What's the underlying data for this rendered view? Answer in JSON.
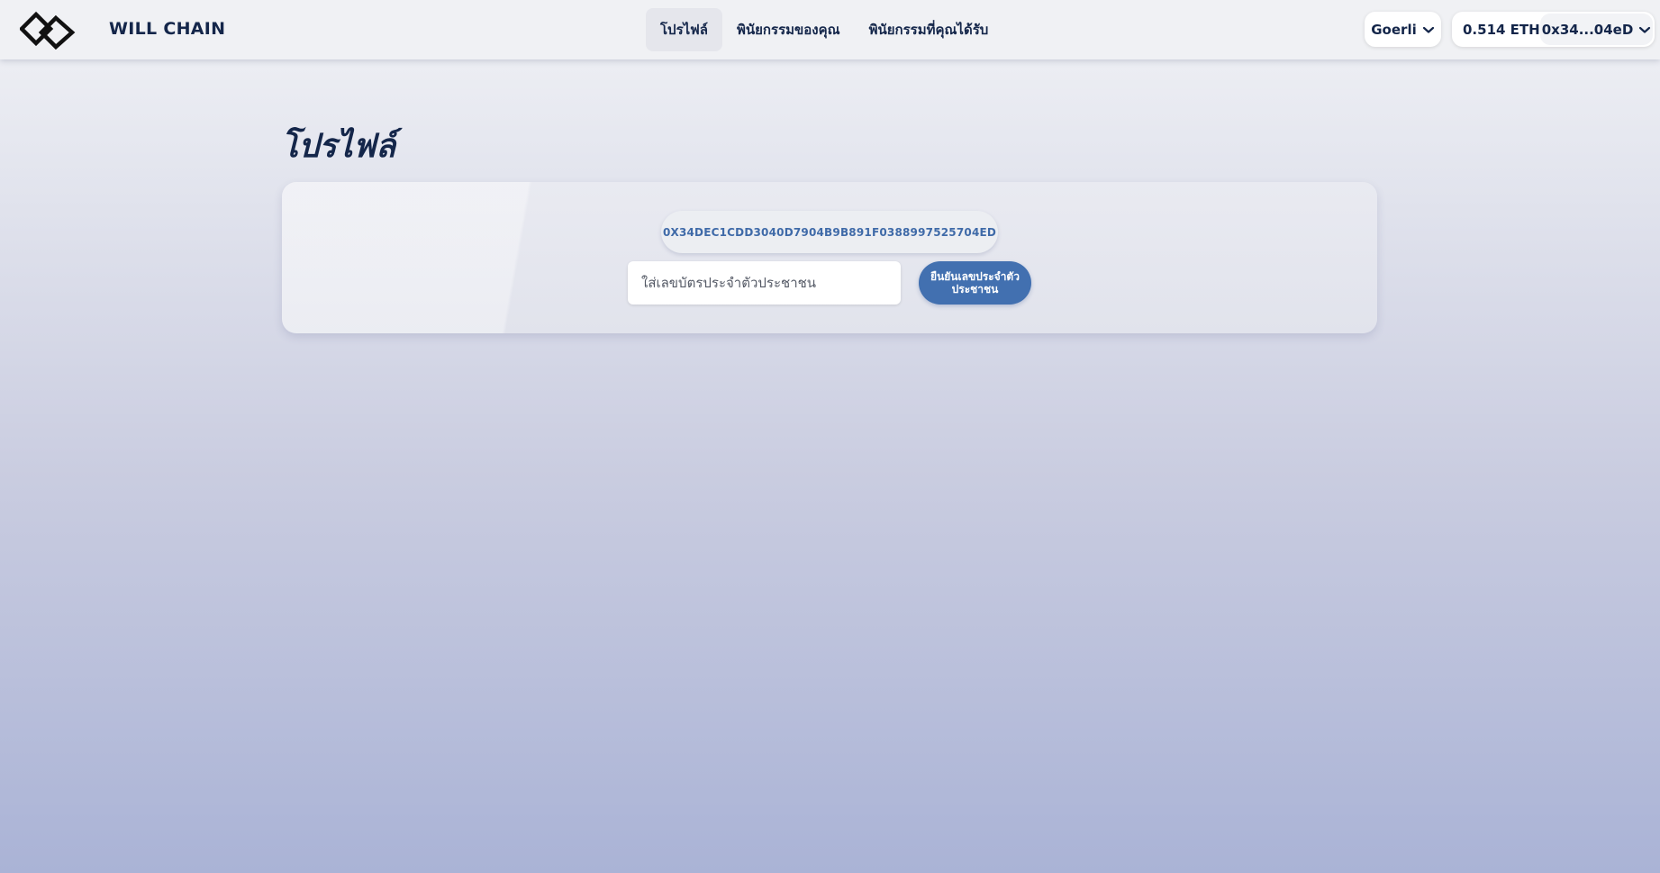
{
  "header": {
    "brand": "WILL CHAIN",
    "logo_icon": "will-chain-logo-icon",
    "nav": [
      {
        "label": "โปรไฟล์",
        "active": true
      },
      {
        "label": "พินัยกรรมของคุณ",
        "active": false
      },
      {
        "label": "พินัยกรรมที่คุณได้รับ",
        "active": false
      }
    ],
    "network": "Goerli",
    "balance": "0.514 ETH",
    "address": "0x34...04eD",
    "chevron_icon": "chevron-down-icon"
  },
  "main": {
    "title": "โปรไฟล์",
    "wallet_address": "0X34DEC1CDD3040D7904B9B891F0388997525704ED",
    "id_input_placeholder": "ใส่เลขบัตรประจำตัวประชาชน",
    "id_input_value": "",
    "confirm_button": "ยืนยันเลขประจำตัวประชาชน"
  },
  "colors": {
    "brand_text": "#14264a",
    "accent": "#4270b0",
    "wallet_text": "#3f6aa8"
  }
}
